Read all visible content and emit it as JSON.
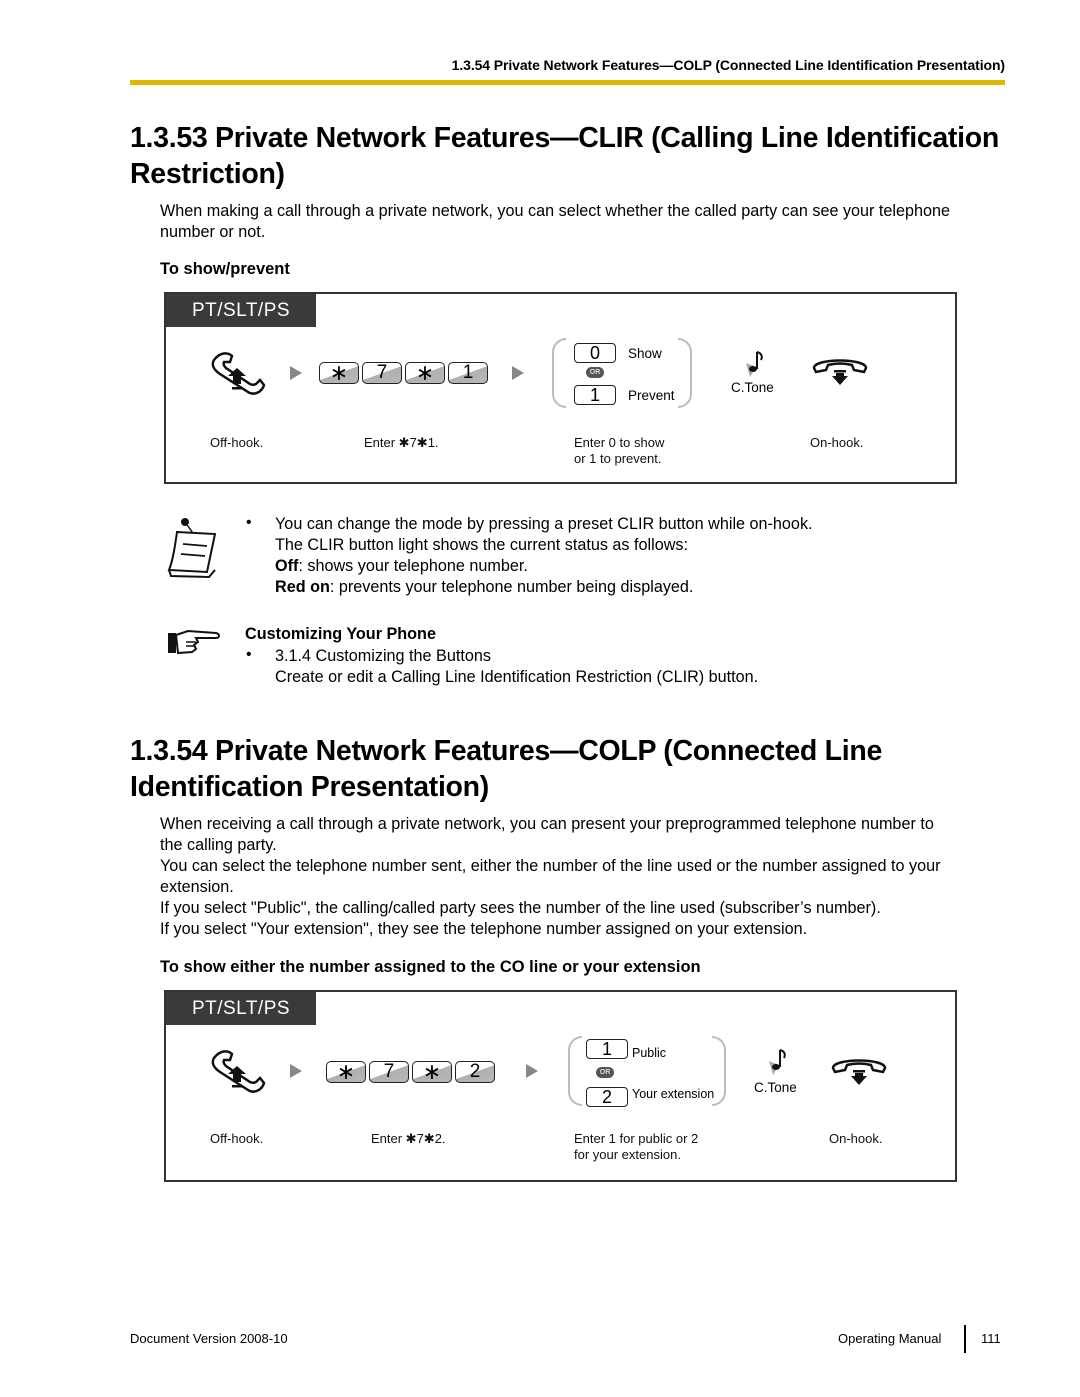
{
  "running_header": "1.3.54 Private Network Features—COLP (Connected Line Identification Presentation)",
  "accent_color": "#e0b800",
  "section_clir": {
    "title_line1": "1.3.53  Private Network Features—CLIR (Calling Line Identification",
    "title_line2": "Restriction)",
    "intro_line1": "When making a call through a private network, you can select whether the called party can see your telephone",
    "intro_line2": "number or not.",
    "subheading": "To show/prevent",
    "procedure": {
      "tab_label": "PT/SLT/PS",
      "keys": [
        "∗",
        "7",
        "∗",
        "1"
      ],
      "choices": [
        {
          "key": "0",
          "label": "Show"
        },
        {
          "key": "1",
          "label": "Prevent"
        }
      ],
      "or_label": "OR",
      "ctone_label": "C.Tone",
      "captions": {
        "offhook": "Off-hook.",
        "enter": "Enter ✱7✱1.",
        "choice_line1": "Enter 0 to show",
        "choice_line2": "or 1 to prevent.",
        "onhook": "On-hook."
      }
    },
    "note": {
      "bullet": "•",
      "line1": "You can change the mode by pressing a preset CLIR button while on-hook.",
      "line2": "The CLIR button light shows the current status as follows:",
      "off_label": "Off",
      "off_text": ": shows your telephone number.",
      "red_label": "Red on",
      "red_text": ": prevents your telephone number being displayed."
    },
    "customizing": {
      "heading": "Customizing Your Phone",
      "bullet": "•",
      "link": "3.1.4  Customizing the Buttons",
      "description": "Create or edit a Calling Line Identification Restriction (CLIR) button."
    }
  },
  "section_colp": {
    "title_line1": "1.3.54  Private Network Features—COLP (Connected Line",
    "title_line2": "Identification Presentation)",
    "paragraphs": [
      "When receiving a call through a private network, you can present your preprogrammed telephone number to",
      "the calling party.",
      "You can select the telephone number sent, either the number of the line used or the number assigned to your",
      "extension.",
      "If you select \"Public\", the calling/called party sees the number of the line used (subscriber’s number).",
      "If you select \"Your extension\", they see the telephone number assigned on your extension."
    ],
    "subheading": "To show either the number assigned to the CO line or your extension",
    "procedure": {
      "tab_label": "PT/SLT/PS",
      "keys": [
        "∗",
        "7",
        "∗",
        "2"
      ],
      "choices": [
        {
          "key": "1",
          "label": "Public"
        },
        {
          "key": "2",
          "label": "Your extension"
        }
      ],
      "or_label": "OR",
      "ctone_label": "C.Tone",
      "captions": {
        "offhook": "Off-hook.",
        "enter": "Enter ✱7✱2.",
        "choice_line1": "Enter 1 for public or 2",
        "choice_line2": "for your extension.",
        "onhook": "On-hook."
      }
    }
  },
  "footer": {
    "document_version": "Document Version  2008-10",
    "manual": "Operating Manual",
    "page": "111"
  }
}
